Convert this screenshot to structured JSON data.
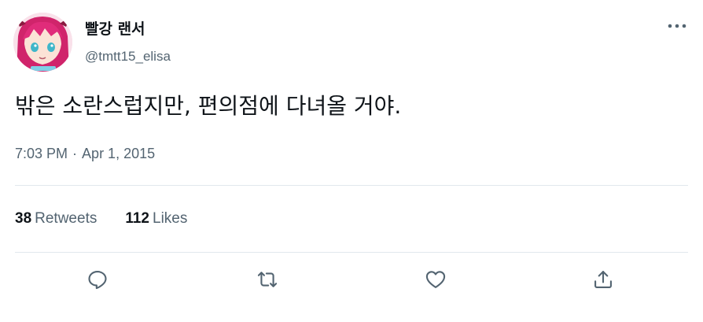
{
  "author": {
    "display_name": "빨강 랜서",
    "handle": "@tmtt15_elisa"
  },
  "tweet": {
    "text": "밖은 소란스럽지만, 편의점에 다녀올 거야.",
    "time": "7:03 PM",
    "separator": "·",
    "date": "Apr 1, 2015"
  },
  "stats": {
    "retweets_count": "38",
    "retweets_label": "Retweets",
    "likes_count": "112",
    "likes_label": "Likes"
  },
  "icons": {
    "more": "more-horizontal-icon",
    "reply": "reply-icon",
    "retweet": "retweet-icon",
    "like": "like-heart-icon",
    "share": "share-icon"
  },
  "colors": {
    "text": "#0f1419",
    "secondary": "#536471",
    "divider": "#e1e8ed"
  }
}
